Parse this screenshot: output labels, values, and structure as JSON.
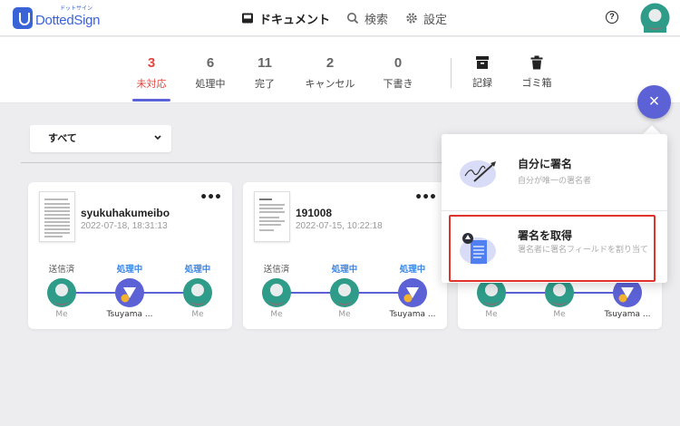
{
  "header": {
    "logo_text": "DottedSign",
    "logo_sub": "ドットサイン",
    "nav": {
      "documents": "ドキュメント",
      "search": "検索",
      "settings": "設定"
    },
    "help_label": "?"
  },
  "status_tabs": [
    {
      "count": "3",
      "label": "未対応",
      "active": true
    },
    {
      "count": "6",
      "label": "処理中"
    },
    {
      "count": "11",
      "label": "完了"
    },
    {
      "count": "2",
      "label": "キャンセル"
    },
    {
      "count": "0",
      "label": "下書き"
    }
  ],
  "tool_tabs": {
    "archive": "記録",
    "trash": "ゴミ箱"
  },
  "filter": {
    "selected": "すべて"
  },
  "cards": [
    {
      "title": "syukuhakumeibo",
      "date": "2022-07-18, 18:31:13",
      "steps": [
        {
          "status": "送信済",
          "name": "Me"
        },
        {
          "status": "処理中",
          "name": "Tsuyama ..."
        },
        {
          "status": "処理中",
          "name": "Me"
        }
      ]
    },
    {
      "title": "191008",
      "date": "2022-07-15, 10:22:18",
      "steps": [
        {
          "status": "送信済",
          "name": "Me"
        },
        {
          "status": "処理中",
          "name": "Me"
        },
        {
          "status": "処理中",
          "name": "Tsuyama ..."
        }
      ]
    },
    {
      "title": "",
      "date": "",
      "steps": [
        {
          "status": "",
          "name": "Me"
        },
        {
          "status": "",
          "name": "Me"
        },
        {
          "status": "",
          "name": "Tsuyama ..."
        }
      ]
    }
  ],
  "fab": {
    "label": "×"
  },
  "menu": {
    "self_sign": {
      "title": "自分に署名",
      "desc": "自分が唯一の署名者"
    },
    "request_sign": {
      "title": "署名を取得",
      "desc": "署名者に署名フィールドを割り当て"
    }
  },
  "colors": {
    "accent": "#5c62d6",
    "active": "#e0463e",
    "avatar": "#2f9c8a",
    "highlight": "#e0342a"
  }
}
